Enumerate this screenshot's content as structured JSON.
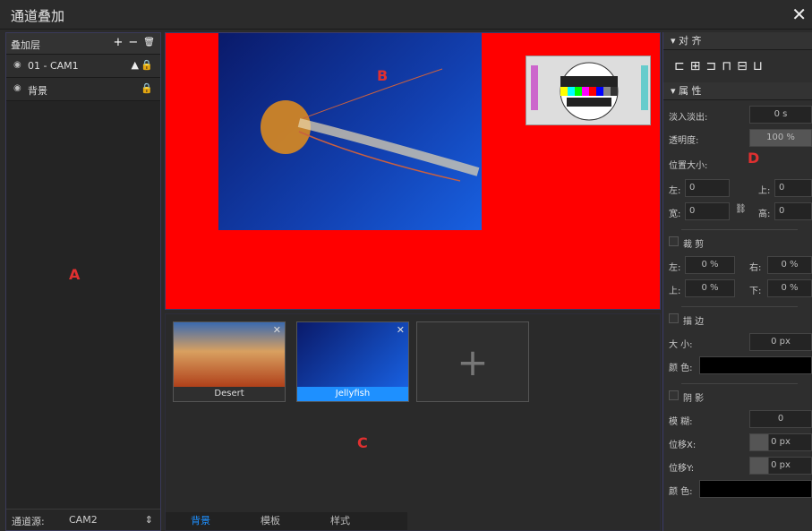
{
  "title": "通道叠加",
  "close": "✕",
  "panelA": {
    "header": "叠加层",
    "add": "+",
    "remove": "−",
    "delete": "🗑",
    "layers": [
      {
        "name": "01 - CAM1",
        "eye": "◉"
      },
      {
        "name": "背景",
        "eye": "◉"
      }
    ],
    "footer_label": "通道源:",
    "footer_value": "CAM2",
    "marker": "A"
  },
  "preview": {
    "marker": "B"
  },
  "sources": {
    "marker": "C",
    "items": [
      {
        "caption": "Desert"
      },
      {
        "caption": "Jellyfish"
      }
    ],
    "add": "+",
    "tabs": [
      "背景",
      "模板",
      "样式"
    ]
  },
  "panelD": {
    "marker": "D",
    "align_header": "▾ 对 齐",
    "props_header": "▾ 属 性",
    "fade_label": "淡入淡出:",
    "fade_value": "0 s",
    "opacity_label": "透明度:",
    "opacity_value": "100 %",
    "pos_label": "位置大小:",
    "left_label": "左:",
    "left_value": "0",
    "top_label": "上:",
    "top_value": "0",
    "width_label": "宽:",
    "width_value": "0",
    "height_label": "高:",
    "height_value": "0",
    "crop_label": "裁 剪",
    "crop_left_label": "左:",
    "crop_left": "0 %",
    "crop_right_label": "右:",
    "crop_right": "0 %",
    "crop_top_label": "上:",
    "crop_top": "0 %",
    "crop_bottom_label": "下:",
    "crop_bottom": "0 %",
    "stroke_label": "描 边",
    "size_label": "大 小:",
    "size_value": "0 px",
    "color_label": "颜 色:",
    "shadow_label": "阴 影",
    "blur_label": "模 糊:",
    "blur_value": "0",
    "offx_label": "位移X:",
    "offx_value": "0 px",
    "offy_label": "位移Y:",
    "offy_value": "0 px",
    "shadow_color_label": "颜 色:"
  },
  "colors": {
    "preview_bg": "#ff0000",
    "marker": "#e03030",
    "accent": "#1e90ff"
  }
}
